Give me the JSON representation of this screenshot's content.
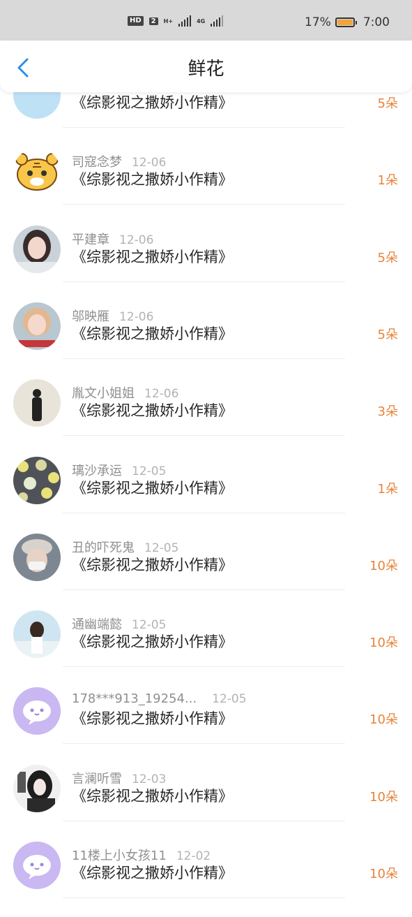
{
  "status_bar": {
    "hd_label": "HD",
    "sim_number": "2",
    "net1": "H+",
    "net2": "4G",
    "battery_percent": "17%",
    "battery_level": 0.17,
    "time": "7:00"
  },
  "header": {
    "title": "鲜花"
  },
  "colors": {
    "count": "#e8833a",
    "accent_back": "#2d8ee6",
    "default_avatar_bg": "#c9b8f2"
  },
  "items": [
    {
      "name": "",
      "date": "",
      "book": "《综影视之撒娇小作精》",
      "count": "5朵",
      "avatar": "text-sticker-avatar"
    },
    {
      "name": "司寇念梦",
      "date": "12-06",
      "book": "《综影视之撒娇小作精》",
      "count": "1朵",
      "avatar": "tiger-avatar"
    },
    {
      "name": "平建章",
      "date": "12-06",
      "book": "《综影视之撒娇小作精》",
      "count": "5朵",
      "avatar": "photo-girl-avatar"
    },
    {
      "name": "邬映雁",
      "date": "12-06",
      "book": "《综影视之撒娇小作精》",
      "count": "5朵",
      "avatar": "photo-girl2-avatar"
    },
    {
      "name": "胤文小姐姐",
      "date": "12-06",
      "book": "《综影视之撒娇小作精》",
      "count": "3朵",
      "avatar": "silhouette-avatar"
    },
    {
      "name": "璃沙承运",
      "date": "12-05",
      "book": "《综影视之撒娇小作精》",
      "count": "1朵",
      "avatar": "floral-avatar"
    },
    {
      "name": "丑的吓死鬼",
      "date": "12-05",
      "book": "《综影视之撒娇小作精》",
      "count": "10朵",
      "avatar": "masked-avatar"
    },
    {
      "name": "通幽端懿",
      "date": "12-05",
      "book": "《综影视之撒娇小作精》",
      "count": "10朵",
      "avatar": "beach-girl-avatar"
    },
    {
      "name": "178***913_19254...",
      "date": "12-05",
      "book": "《综影视之撒娇小作精》",
      "count": "10朵",
      "avatar": "default-chat-avatar"
    },
    {
      "name": "言澜听雪",
      "date": "12-03",
      "book": "《综影视之撒娇小作精》",
      "count": "10朵",
      "avatar": "anime-avatar"
    },
    {
      "name": "11楼上小女孩11",
      "date": "12-02",
      "book": "《综影视之撒娇小作精》",
      "count": "10朵",
      "avatar": "default-chat-avatar"
    }
  ]
}
